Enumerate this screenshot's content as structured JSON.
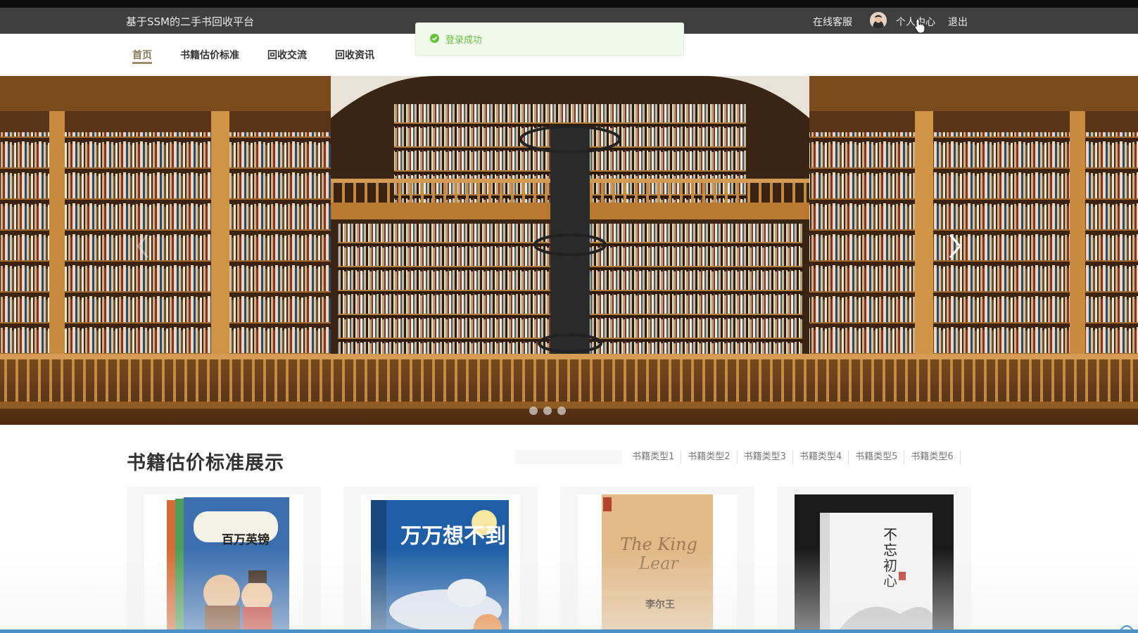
{
  "header": {
    "site_title": "基于SSM的二手书回收平台",
    "service_label": "在线客服",
    "user_center_label": "个人中心",
    "logout_label": "退出"
  },
  "toast": {
    "message": "登录成功",
    "status": "success",
    "color": "#67c23a"
  },
  "nav": {
    "items": [
      {
        "label": "首页",
        "active": true
      },
      {
        "label": "书籍估价标准",
        "active": false
      },
      {
        "label": "回收交流",
        "active": false
      },
      {
        "label": "回收资讯",
        "active": false
      }
    ]
  },
  "banner": {
    "slides": 3,
    "active_slide": 1,
    "prev_icon": "chevron-left-icon",
    "next_icon": "chevron-right-icon"
  },
  "section": {
    "title": "书籍估价标准展示",
    "categories": [
      "书籍类型1",
      "书籍类型2",
      "书籍类型3",
      "书籍类型4",
      "书籍类型5",
      "书籍类型6"
    ]
  },
  "books": [
    {
      "cover_text": "百万英镑",
      "cover_color": "#3b6fb0"
    },
    {
      "cover_text": "万万想不到",
      "cover_color": "#1f5fa8"
    },
    {
      "cover_text": "The King Lear",
      "cover_subtext": "李尔王",
      "cover_color": "#e2b987"
    },
    {
      "cover_text": "不忘初心",
      "cover_color": "#1a1a1a"
    }
  ],
  "colors": {
    "topbar": "#3f3f3f",
    "nav_active": "#8a7a5a",
    "accent_blue": "#4a90c8"
  }
}
